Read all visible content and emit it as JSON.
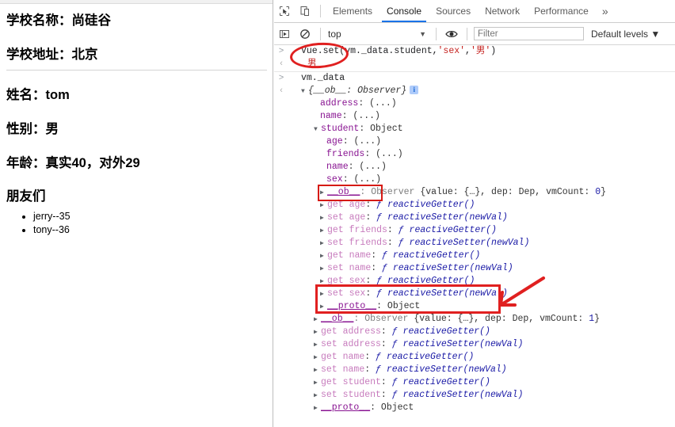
{
  "page": {
    "school_name": "学校名称：尚硅谷",
    "school_address": "学校地址：北京",
    "student_name": "姓名：tom",
    "student_sex": "性别：男",
    "student_age": "年龄：真实40，对外29",
    "friends_heading": "朋友们",
    "friends": [
      "jerry--35",
      "tony--36"
    ]
  },
  "devtools": {
    "icons": {
      "inspect": "inspect-element-icon",
      "device": "device-toolbar-icon",
      "execute": "execute-snippet-icon",
      "clear": "clear-console-icon",
      "eye": "live-expression-icon"
    },
    "tabs": [
      {
        "label": "Elements",
        "active": false
      },
      {
        "label": "Console",
        "active": true
      },
      {
        "label": "Sources",
        "active": false
      },
      {
        "label": "Network",
        "active": false
      },
      {
        "label": "Performance",
        "active": false
      }
    ],
    "more_tabs_label": "»",
    "toolbar": {
      "context": "top",
      "context_caret": "▼",
      "filter_placeholder": "Filter",
      "filter_value": "",
      "levels": "Default levels",
      "levels_caret": "▼"
    },
    "accent_color": "#1a73e8",
    "annotation_color": "#e02020"
  },
  "console": {
    "prompt_glyph": ">",
    "output_glyph": "‹",
    "lines": [
      {
        "id": "cmd1",
        "kind": "input",
        "indent": 0,
        "tokens": [
          {
            "t": "Vue.set(vm._data.student,",
            "c": "plain"
          },
          {
            "t": "'sex'",
            "c": "str"
          },
          {
            "t": ",",
            "c": "plain"
          },
          {
            "t": "'男'",
            "c": "str"
          },
          {
            "t": ")",
            "c": "plain"
          }
        ]
      },
      {
        "id": "res1",
        "kind": "output",
        "indent": 1,
        "divider": true,
        "tokens": [
          {
            "t": "男",
            "c": "str"
          }
        ]
      },
      {
        "id": "cmd2",
        "kind": "input",
        "indent": 0,
        "tokens": [
          {
            "t": "vm._data",
            "c": "plain"
          }
        ]
      },
      {
        "id": "res2",
        "kind": "output",
        "indent": 0,
        "tri": "open",
        "tokens": [
          {
            "t": "{__ob__: Observer}",
            "c": "ital"
          },
          {
            "t": "INFO",
            "c": "info"
          }
        ]
      },
      {
        "id": "l-address",
        "kind": "plain",
        "indent": 3,
        "tokens": [
          {
            "t": "address",
            "c": "key"
          },
          {
            "t": ": (...)",
            "c": "obj"
          }
        ]
      },
      {
        "id": "l-name",
        "kind": "plain",
        "indent": 3,
        "tokens": [
          {
            "t": "name",
            "c": "key"
          },
          {
            "t": ": (...)",
            "c": "obj"
          }
        ]
      },
      {
        "id": "l-student",
        "kind": "plain",
        "indent": 2,
        "tri": "open",
        "tokens": [
          {
            "t": "student",
            "c": "key"
          },
          {
            "t": ": Object",
            "c": "obj"
          }
        ]
      },
      {
        "id": "l-age",
        "kind": "plain",
        "indent": 4,
        "tokens": [
          {
            "t": "age",
            "c": "key"
          },
          {
            "t": ": (...)",
            "c": "obj"
          }
        ]
      },
      {
        "id": "l-friends",
        "kind": "plain",
        "indent": 4,
        "tokens": [
          {
            "t": "friends",
            "c": "key"
          },
          {
            "t": ": (...)",
            "c": "obj"
          }
        ]
      },
      {
        "id": "l-name2",
        "kind": "plain",
        "indent": 4,
        "tokens": [
          {
            "t": "name",
            "c": "key"
          },
          {
            "t": ": (...)",
            "c": "obj"
          }
        ]
      },
      {
        "id": "l-sex",
        "kind": "plain",
        "indent": 4,
        "tokens": [
          {
            "t": "sex",
            "c": "key"
          },
          {
            "t": ": (...)",
            "c": "obj"
          }
        ]
      },
      {
        "id": "l-ob0",
        "kind": "plain",
        "indent": 3,
        "tri": "closed",
        "tokens": [
          {
            "t": "__ob__",
            "c": "ob"
          },
          {
            "t": ": Observer ",
            "c": "dim"
          },
          {
            "t": "{value: {…}, dep: Dep, vmCount: ",
            "c": "obj"
          },
          {
            "t": "0",
            "c": "num"
          },
          {
            "t": "}",
            "c": "obj"
          }
        ]
      },
      {
        "id": "l-get-age",
        "kind": "plain",
        "indent": 3,
        "tri": "closed",
        "tokens": [
          {
            "t": "get ",
            "c": "keylight"
          },
          {
            "t": "age",
            "c": "keylight"
          },
          {
            "t": ": ",
            "c": "obj"
          },
          {
            "t": "ƒ reactiveGetter()",
            "c": "fn"
          }
        ]
      },
      {
        "id": "l-set-age",
        "kind": "plain",
        "indent": 3,
        "tri": "closed",
        "tokens": [
          {
            "t": "set ",
            "c": "keylight"
          },
          {
            "t": "age",
            "c": "keylight"
          },
          {
            "t": ": ",
            "c": "obj"
          },
          {
            "t": "ƒ reactiveSetter(newVal)",
            "c": "fn"
          }
        ]
      },
      {
        "id": "l-get-friends",
        "kind": "plain",
        "indent": 3,
        "tri": "closed",
        "tokens": [
          {
            "t": "get ",
            "c": "keylight"
          },
          {
            "t": "friends",
            "c": "keylight"
          },
          {
            "t": ": ",
            "c": "obj"
          },
          {
            "t": "ƒ reactiveGetter()",
            "c": "fn"
          }
        ]
      },
      {
        "id": "l-set-friends",
        "kind": "plain",
        "indent": 3,
        "tri": "closed",
        "tokens": [
          {
            "t": "set ",
            "c": "keylight"
          },
          {
            "t": "friends",
            "c": "keylight"
          },
          {
            "t": ": ",
            "c": "obj"
          },
          {
            "t": "ƒ reactiveSetter(newVal)",
            "c": "fn"
          }
        ]
      },
      {
        "id": "l-get-name",
        "kind": "plain",
        "indent": 3,
        "tri": "closed",
        "tokens": [
          {
            "t": "get ",
            "c": "keylight"
          },
          {
            "t": "name",
            "c": "keylight"
          },
          {
            "t": ": ",
            "c": "obj"
          },
          {
            "t": "ƒ reactiveGetter()",
            "c": "fn"
          }
        ]
      },
      {
        "id": "l-set-name",
        "kind": "plain",
        "indent": 3,
        "tri": "closed",
        "tokens": [
          {
            "t": "set ",
            "c": "keylight"
          },
          {
            "t": "name",
            "c": "keylight"
          },
          {
            "t": ": ",
            "c": "obj"
          },
          {
            "t": "ƒ reactiveSetter(newVal)",
            "c": "fn"
          }
        ]
      },
      {
        "id": "l-get-sex",
        "kind": "plain",
        "indent": 3,
        "tri": "closed",
        "tokens": [
          {
            "t": "get ",
            "c": "keylight"
          },
          {
            "t": "sex",
            "c": "keylight"
          },
          {
            "t": ": ",
            "c": "obj"
          },
          {
            "t": "ƒ reactiveGetter()",
            "c": "fn"
          }
        ]
      },
      {
        "id": "l-set-sex",
        "kind": "plain",
        "indent": 3,
        "tri": "closed",
        "tokens": [
          {
            "t": "set ",
            "c": "keylight"
          },
          {
            "t": "sex",
            "c": "keylight"
          },
          {
            "t": ": ",
            "c": "obj"
          },
          {
            "t": "ƒ reactiveSetter(newVal)",
            "c": "fn"
          }
        ]
      },
      {
        "id": "l-proto1",
        "kind": "plain",
        "indent": 3,
        "tri": "closed",
        "tokens": [
          {
            "t": "__proto__",
            "c": "proto"
          },
          {
            "t": ": Object",
            "c": "obj"
          }
        ]
      },
      {
        "id": "l-ob1",
        "kind": "plain",
        "indent": 2,
        "tri": "closed",
        "tokens": [
          {
            "t": "__ob__",
            "c": "ob"
          },
          {
            "t": ": Observer ",
            "c": "dim"
          },
          {
            "t": "{value: {…}, dep: Dep, vmCount: ",
            "c": "obj"
          },
          {
            "t": "1",
            "c": "num"
          },
          {
            "t": "}",
            "c": "obj"
          }
        ]
      },
      {
        "id": "l-get-address",
        "kind": "plain",
        "indent": 2,
        "tri": "closed",
        "tokens": [
          {
            "t": "get ",
            "c": "keylight"
          },
          {
            "t": "address",
            "c": "keylight"
          },
          {
            "t": ": ",
            "c": "obj"
          },
          {
            "t": "ƒ reactiveGetter()",
            "c": "fn"
          }
        ]
      },
      {
        "id": "l-set-address",
        "kind": "plain",
        "indent": 2,
        "tri": "closed",
        "tokens": [
          {
            "t": "set ",
            "c": "keylight"
          },
          {
            "t": "address",
            "c": "keylight"
          },
          {
            "t": ": ",
            "c": "obj"
          },
          {
            "t": "ƒ reactiveSetter(newVal)",
            "c": "fn"
          }
        ]
      },
      {
        "id": "l-get-name3",
        "kind": "plain",
        "indent": 2,
        "tri": "closed",
        "tokens": [
          {
            "t": "get ",
            "c": "keylight"
          },
          {
            "t": "name",
            "c": "keylight"
          },
          {
            "t": ": ",
            "c": "obj"
          },
          {
            "t": "ƒ reactiveGetter()",
            "c": "fn"
          }
        ]
      },
      {
        "id": "l-set-name3",
        "kind": "plain",
        "indent": 2,
        "tri": "closed",
        "tokens": [
          {
            "t": "set ",
            "c": "keylight"
          },
          {
            "t": "name",
            "c": "keylight"
          },
          {
            "t": ": ",
            "c": "obj"
          },
          {
            "t": "ƒ reactiveSetter(newVal)",
            "c": "fn"
          }
        ]
      },
      {
        "id": "l-get-student",
        "kind": "plain",
        "indent": 2,
        "tri": "closed",
        "tokens": [
          {
            "t": "get ",
            "c": "keylight"
          },
          {
            "t": "student",
            "c": "keylight"
          },
          {
            "t": ": ",
            "c": "obj"
          },
          {
            "t": "ƒ reactiveGetter()",
            "c": "fn"
          }
        ]
      },
      {
        "id": "l-set-student",
        "kind": "plain",
        "indent": 2,
        "tri": "closed",
        "tokens": [
          {
            "t": "set ",
            "c": "keylight"
          },
          {
            "t": "student",
            "c": "keylight"
          },
          {
            "t": ": ",
            "c": "obj"
          },
          {
            "t": "ƒ reactiveSetter(newVal)",
            "c": "fn"
          }
        ]
      },
      {
        "id": "l-proto2",
        "kind": "plain",
        "indent": 2,
        "tri": "closed",
        "tokens": [
          {
            "t": "__proto__",
            "c": "proto"
          },
          {
            "t": ": Object",
            "c": "obj"
          }
        ]
      }
    ]
  },
  "annotations": [
    {
      "name": "ellipse-around-vue-set",
      "shape": "ellipse"
    },
    {
      "name": "box-around-sex-property",
      "shape": "rect"
    },
    {
      "name": "box-around-get-set-sex",
      "shape": "rect"
    },
    {
      "name": "arrow-pointing-to-get-set-sex",
      "shape": "arrow"
    }
  ]
}
